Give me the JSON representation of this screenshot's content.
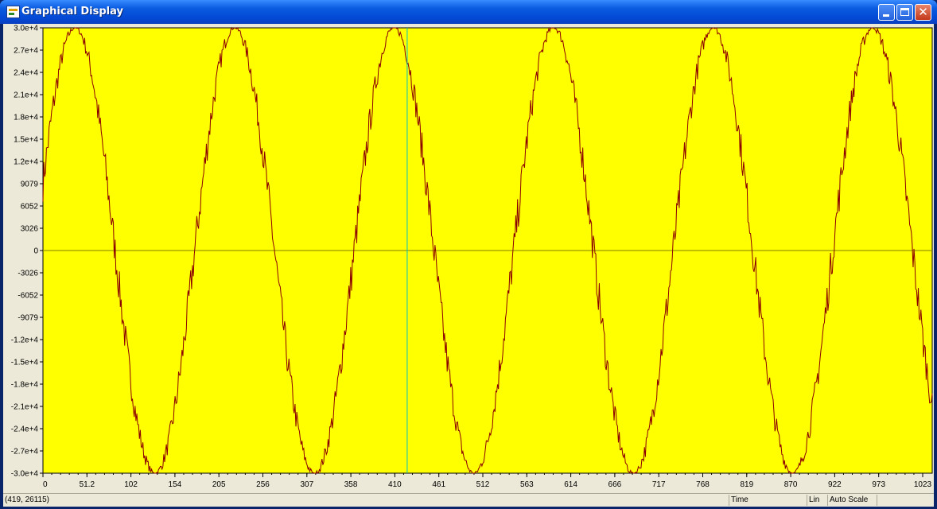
{
  "window": {
    "title": "Graphical Display",
    "buttons": {
      "minimize": "_",
      "maximize": "□",
      "close": "✕"
    }
  },
  "colors": {
    "plot_background": "#ffff00",
    "trace": "#8b0000",
    "cursor_line": "#00c0c0",
    "zero_line": "#808000"
  },
  "chart_data": {
    "type": "line",
    "title": "",
    "xlabel": "",
    "ylabel": "",
    "x_ticks": [
      "0",
      "51.2",
      "102",
      "154",
      "205",
      "256",
      "307",
      "358",
      "410",
      "461",
      "512",
      "563",
      "614",
      "666",
      "717",
      "768",
      "819",
      "870",
      "922",
      "973",
      "1023"
    ],
    "y_ticks": [
      "3.0e+4",
      "2.7e+4",
      "2.4e+4",
      "2.1e+4",
      "1.8e+4",
      "1.5e+4",
      "1.2e+4",
      "9079",
      "6052",
      "3026",
      "0",
      "-3026",
      "-6052",
      "-9079",
      "-1.2e+4",
      "-1.5e+4",
      "-1.8e+4",
      "-2.1e+4",
      "-2.4e+4",
      "-2.7e+4",
      "-3.0e+4"
    ],
    "xlim": [
      0,
      1023
    ],
    "ylim": [
      -30260,
      30260
    ],
    "series": [
      {
        "signal": "sine",
        "amplitude": 30260,
        "period": 183.5,
        "phase_x": 37,
        "noise_amplitude": 2500,
        "samples": 1024
      }
    ],
    "cursor_x": 419,
    "grid": false
  },
  "status": {
    "cursor_readout": "(419, 26115)",
    "domain": "Time",
    "scale": "Lin",
    "auto": "Auto Scale"
  }
}
